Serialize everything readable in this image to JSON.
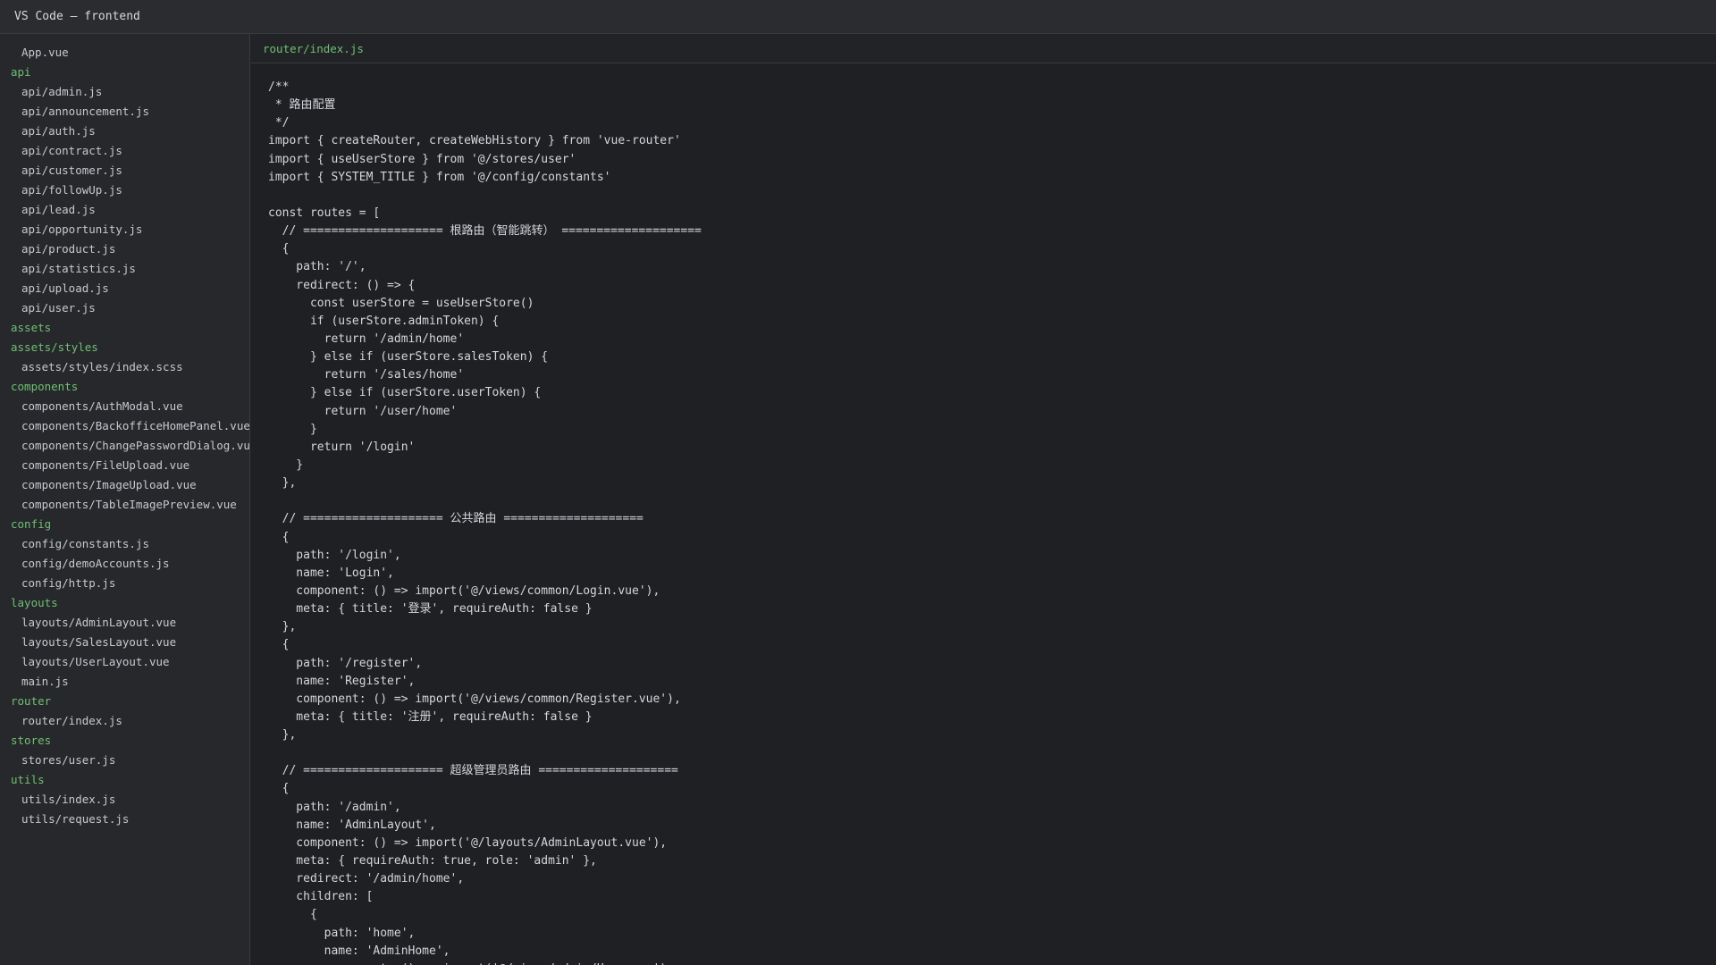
{
  "window": {
    "title": "VS Code — frontend"
  },
  "explorer": [
    {
      "type": "file",
      "label": "App.vue"
    },
    {
      "type": "folder",
      "label": "api"
    },
    {
      "type": "file",
      "label": "api/admin.js"
    },
    {
      "type": "file",
      "label": "api/announcement.js"
    },
    {
      "type": "file",
      "label": "api/auth.js"
    },
    {
      "type": "file",
      "label": "api/contract.js"
    },
    {
      "type": "file",
      "label": "api/customer.js"
    },
    {
      "type": "file",
      "label": "api/followUp.js"
    },
    {
      "type": "file",
      "label": "api/lead.js"
    },
    {
      "type": "file",
      "label": "api/opportunity.js"
    },
    {
      "type": "file",
      "label": "api/product.js"
    },
    {
      "type": "file",
      "label": "api/statistics.js"
    },
    {
      "type": "file",
      "label": "api/upload.js"
    },
    {
      "type": "file",
      "label": "api/user.js"
    },
    {
      "type": "folder",
      "label": "assets"
    },
    {
      "type": "folder",
      "label": "assets/styles"
    },
    {
      "type": "file",
      "label": "assets/styles/index.scss"
    },
    {
      "type": "folder",
      "label": "components"
    },
    {
      "type": "file",
      "label": "components/AuthModal.vue"
    },
    {
      "type": "file",
      "label": "components/BackofficeHomePanel.vue"
    },
    {
      "type": "file",
      "label": "components/ChangePasswordDialog.vue"
    },
    {
      "type": "file",
      "label": "components/FileUpload.vue"
    },
    {
      "type": "file",
      "label": "components/ImageUpload.vue"
    },
    {
      "type": "file",
      "label": "components/TableImagePreview.vue"
    },
    {
      "type": "folder",
      "label": "config"
    },
    {
      "type": "file",
      "label": "config/constants.js"
    },
    {
      "type": "file",
      "label": "config/demoAccounts.js"
    },
    {
      "type": "file",
      "label": "config/http.js"
    },
    {
      "type": "folder",
      "label": "layouts"
    },
    {
      "type": "file",
      "label": "layouts/AdminLayout.vue"
    },
    {
      "type": "file",
      "label": "layouts/SalesLayout.vue"
    },
    {
      "type": "file",
      "label": "layouts/UserLayout.vue"
    },
    {
      "type": "file",
      "label": "main.js"
    },
    {
      "type": "folder",
      "label": "router"
    },
    {
      "type": "file",
      "label": "router/index.js"
    },
    {
      "type": "folder",
      "label": "stores"
    },
    {
      "type": "file",
      "label": "stores/user.js"
    },
    {
      "type": "folder",
      "label": "utils"
    },
    {
      "type": "file",
      "label": "utils/index.js"
    },
    {
      "type": "file",
      "label": "utils/request.js"
    }
  ],
  "editor": {
    "active_tab": "router/index.js",
    "lines": [
      "/**",
      " * 路由配置",
      " */",
      "import { createRouter, createWebHistory } from 'vue-router'",
      "import { useUserStore } from '@/stores/user'",
      "import { SYSTEM_TITLE } from '@/config/constants'",
      "",
      "const routes = [",
      "  // ==================== 根路由（智能跳转） ====================",
      "  {",
      "    path: '/',",
      "    redirect: () => {",
      "      const userStore = useUserStore()",
      "      if (userStore.adminToken) {",
      "        return '/admin/home'",
      "      } else if (userStore.salesToken) {",
      "        return '/sales/home'",
      "      } else if (userStore.userToken) {",
      "        return '/user/home'",
      "      }",
      "      return '/login'",
      "    }",
      "  },",
      "",
      "  // ==================== 公共路由 ====================",
      "  {",
      "    path: '/login',",
      "    name: 'Login',",
      "    component: () => import('@/views/common/Login.vue'),",
      "    meta: { title: '登录', requireAuth: false }",
      "  },",
      "  {",
      "    path: '/register',",
      "    name: 'Register',",
      "    component: () => import('@/views/common/Register.vue'),",
      "    meta: { title: '注册', requireAuth: false }",
      "  },",
      "",
      "  // ==================== 超级管理员路由 ====================",
      "  {",
      "    path: '/admin',",
      "    name: 'AdminLayout',",
      "    component: () => import('@/layouts/AdminLayout.vue'),",
      "    meta: { requireAuth: true, role: 'admin' },",
      "    redirect: '/admin/home',",
      "    children: [",
      "      {",
      "        path: 'home',",
      "        name: 'AdminHome',",
      "        component: () => import('@/views/admin/Home.vue'),"
    ]
  }
}
